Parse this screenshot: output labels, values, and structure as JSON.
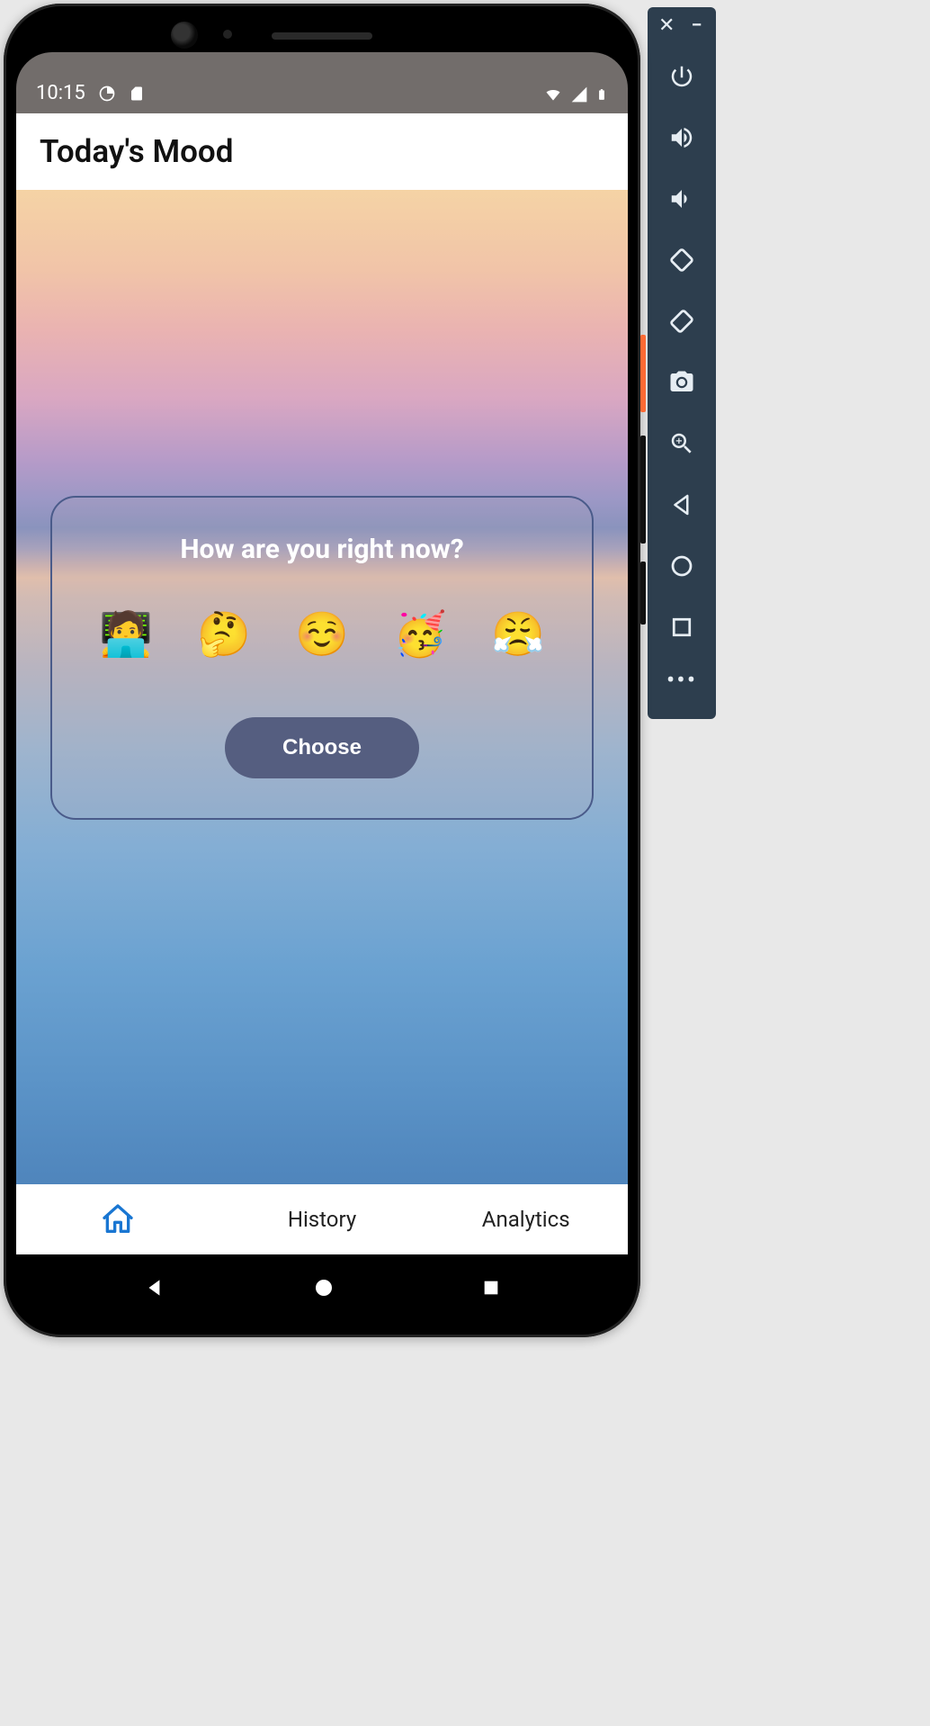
{
  "statusbar": {
    "time": "10:15"
  },
  "app": {
    "title": "Today's Mood"
  },
  "card": {
    "prompt": "How are you right now?",
    "moods": [
      "🧑‍💻",
      "🤔",
      "☺️",
      "🥳",
      "😤"
    ],
    "choose_label": "Choose"
  },
  "bottom_nav": {
    "history": "History",
    "analytics": "Analytics"
  },
  "emulator": {
    "tools": [
      "power",
      "volume-up",
      "volume-down",
      "rotate-left",
      "rotate-right",
      "camera",
      "zoom",
      "back",
      "home",
      "overview",
      "more"
    ]
  }
}
